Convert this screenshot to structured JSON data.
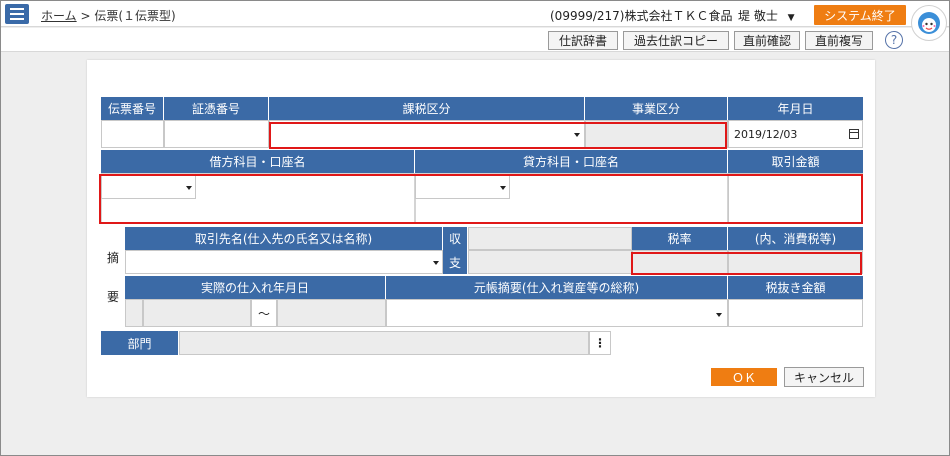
{
  "header": {
    "home_link": "ホーム",
    "separator": ">",
    "page_title": "伝票(１伝票型)",
    "company": "(09999/217)株式会社ＴＫＣ食品",
    "user": "堤 敬士",
    "exit_label": "システム終了"
  },
  "toolbar": {
    "buttons": [
      "仕訳辞書",
      "過去仕訳コピー",
      "直前確認",
      "直前複写"
    ],
    "help": "?"
  },
  "form": {
    "row1_headers": {
      "slip_no": "伝票番号",
      "voucher_no": "証憑番号",
      "tax_class": "課税区分",
      "business_class": "事業区分",
      "date": "年月日"
    },
    "date_value": "2019/12/03",
    "row2_headers": {
      "debit": "借方科目・口座名",
      "credit": "貸方科目・口座名",
      "amount": "取引金額"
    },
    "summary_side": [
      "摘",
      "要"
    ],
    "row3_headers": {
      "partner": "取引先名(仕入先の氏名又は名称)",
      "receive": "収",
      "pay": "支",
      "tax_rate": "税率",
      "tax_incl": "(内、消費税等)"
    },
    "row4_headers": {
      "actual_date": "実際の仕入れ年月日",
      "ledger_summary": "元帳摘要(仕入れ資産等の総称)",
      "net_amount": "税抜き金額"
    },
    "tilde": "～",
    "department": "部門",
    "dept_more": "⋮"
  },
  "actions": {
    "ok": "ＯＫ",
    "cancel": "キャンセル"
  }
}
